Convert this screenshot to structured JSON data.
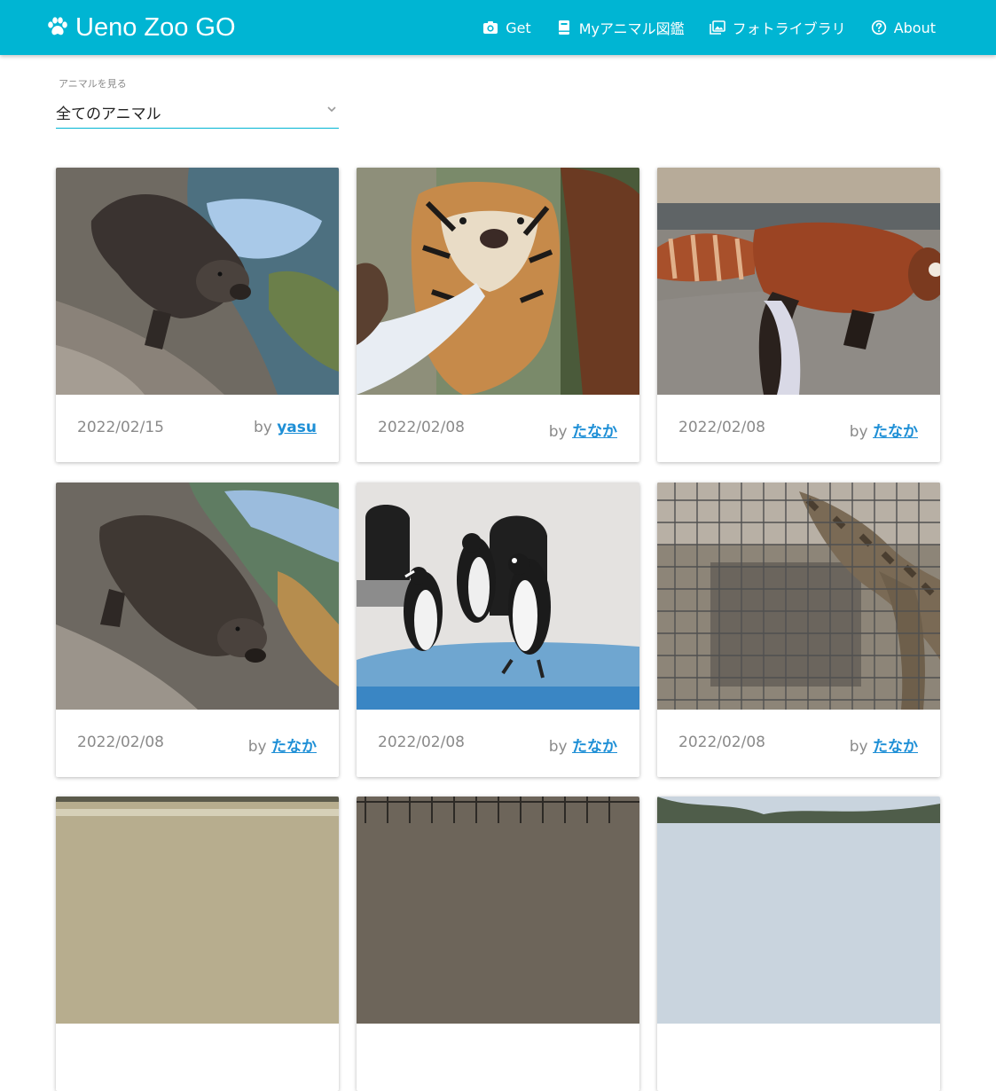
{
  "navbar": {
    "brand": "Ueno Zoo GO",
    "brand_icon": "paw-icon",
    "bg_color": "#00b5d3",
    "items": [
      {
        "label": "Get",
        "icon": "camera-icon"
      },
      {
        "label": "Myアニマル図鑑",
        "icon": "book-icon"
      },
      {
        "label": "フォトライブラリ",
        "icon": "photo-library-icon"
      },
      {
        "label": "About",
        "icon": "help-circle-icon"
      }
    ]
  },
  "filter": {
    "label": "アニマルを見る",
    "selected": "全てのアニマル"
  },
  "cards": [
    {
      "subject": "otter",
      "date": "2022/02/15",
      "by": "by",
      "user": "yasu"
    },
    {
      "subject": "tiger",
      "date": "2022/02/08",
      "by": "by",
      "user": "たなか"
    },
    {
      "subject": "red panda",
      "date": "2022/02/08",
      "by": "by",
      "user": "たなか"
    },
    {
      "subject": "otter",
      "date": "2022/02/08",
      "by": "by",
      "user": "たなか"
    },
    {
      "subject": "penguins",
      "date": "2022/02/08",
      "by": "by",
      "user": "たなか"
    },
    {
      "subject": "giraffe",
      "date": "2022/02/08",
      "by": "by",
      "user": "たなか"
    },
    {
      "subject": "enclosure",
      "date": "",
      "by": "",
      "user": ""
    },
    {
      "subject": "enclosure",
      "date": "",
      "by": "",
      "user": ""
    },
    {
      "subject": "trees",
      "date": "",
      "by": "",
      "user": ""
    }
  ],
  "colors": {
    "accent": "#00b5d3",
    "link": "#1e8fd6",
    "muted_text": "#8a8a8a"
  }
}
